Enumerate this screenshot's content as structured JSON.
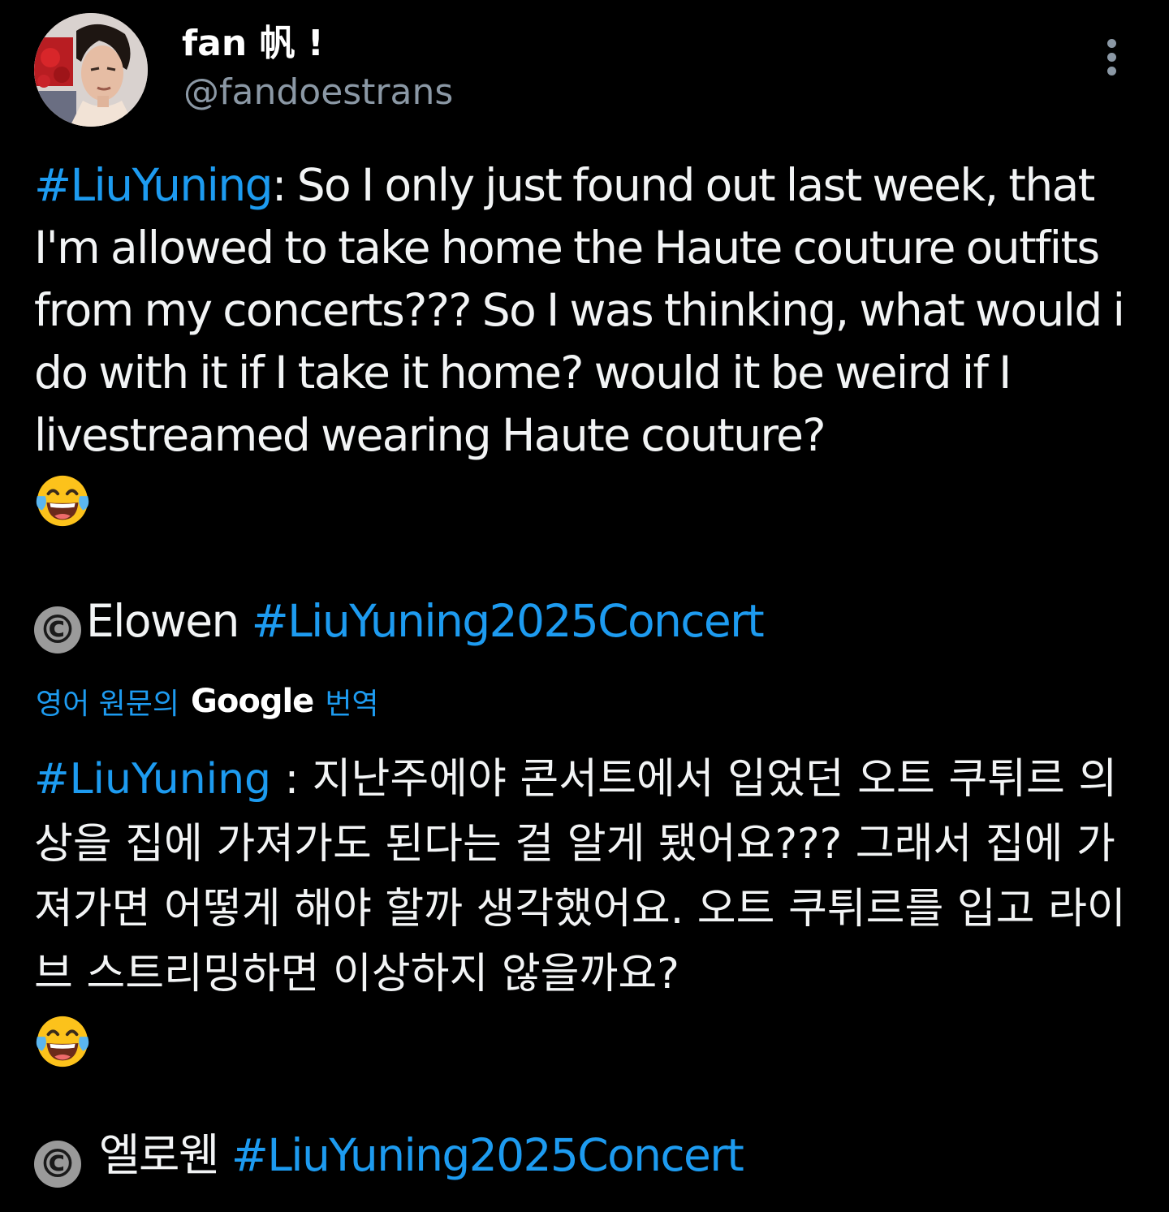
{
  "author": {
    "display_name": "fan 帆 !",
    "handle": "@fandoestrans",
    "avatar": "avatar-photo"
  },
  "menu": {
    "icon": "more-vertical-icon"
  },
  "tweet": {
    "hashtag_main": "#LiuYuning",
    "text": ": So I only just found out last week, that I'm allowed to take home the Haute couture outfits from my concerts??? So I was thinking, what would i do with it if I take it home? would it be weird if I livestreamed wearing Haute couture?",
    "emoji": "face-with-tears-of-joy-icon",
    "credit_symbol": "©",
    "credit_name": "Elowen ",
    "credit_hashtag": "#LiuYuning2025Concert"
  },
  "translation": {
    "prefix": "영어 원문의",
    "provider": "Google",
    "suffix": "번역",
    "hashtag_main": "#LiuYuning",
    "text": " : 지난주에야 콘서트에서 입었던 오트 쿠튀르 의상을 집에 가져가도 된다는 걸 알게 됐어요??? 그래서 집에 가져가면 어떻게 해야 할까 생각했어요. 오트 쿠튀르를 입고 라이브 스트리밍하면 이상하지 않을까요?",
    "emoji": "face-with-tears-of-joy-icon",
    "credit_symbol": "©",
    "credit_name": " 엘로웬 ",
    "credit_hashtag": "#LiuYuning2025Concert"
  },
  "colors": {
    "background": "#000000",
    "text": "#f2f4f5",
    "secondary": "#8b98a5",
    "link": "#1d9bf0"
  }
}
